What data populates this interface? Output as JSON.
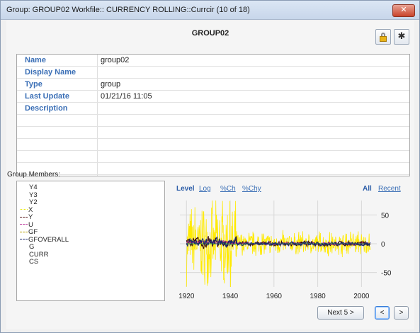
{
  "window": {
    "title": "Group: GROUP02   Workfile:: CURRENCY ROLLING::Currcir (10 of 18)",
    "close_glyph": "✕"
  },
  "header": {
    "title": "GROUP02",
    "lock_icon": "lock-icon",
    "pin_icon": "pin-icon",
    "pin_glyph": "✱"
  },
  "info": [
    {
      "label": "Name",
      "value": "group02"
    },
    {
      "label": "Display Name",
      "value": ""
    },
    {
      "label": "Type",
      "value": "group"
    },
    {
      "label": "Last Update",
      "value": "01/21/16  11:05"
    },
    {
      "label": "Description",
      "value": ""
    }
  ],
  "members_label": "Group Members:",
  "members": [
    {
      "name": "Y4",
      "line": "none",
      "color": ""
    },
    {
      "name": "Y3",
      "line": "none",
      "color": ""
    },
    {
      "name": "Y2",
      "line": "none",
      "color": ""
    },
    {
      "name": "X",
      "line": "dotted",
      "color": "#e8e800"
    },
    {
      "name": "Y",
      "line": "dashed",
      "color": "#5a1a1a"
    },
    {
      "name": "U",
      "line": "dashed",
      "color": "#c040a0"
    },
    {
      "name": "GF",
      "line": "dashed",
      "color": "#b8a000"
    },
    {
      "name": "GFOVERALL",
      "line": "dashed",
      "color": "#1a2a6a"
    },
    {
      "name": "G",
      "line": "none",
      "color": ""
    },
    {
      "name": "CURR",
      "line": "none",
      "color": ""
    },
    {
      "name": "CS",
      "line": "none",
      "color": ""
    }
  ],
  "graph_tabs": {
    "level": "Level",
    "log": "Log",
    "pch": "%Ch",
    "pchy": "%Chy",
    "all": "All",
    "recent": "Recent"
  },
  "chart_data": {
    "type": "line",
    "x_ticks": [
      "1920",
      "1940",
      "1960",
      "1980",
      "2000"
    ],
    "y_ticks": [
      "50",
      "0",
      "-50"
    ],
    "xlim": [
      1917,
      2007
    ],
    "ylim": [
      -75,
      75
    ],
    "grid": true,
    "series": [
      {
        "color": "#ffea00",
        "style": "volatile",
        "amp_early": 60,
        "amp_late": 18
      },
      {
        "color": "#3b0a0a",
        "style": "level",
        "amp_early": 9,
        "amp_late": 4
      },
      {
        "color": "#c02a8a",
        "style": "level",
        "amp_early": 3,
        "amp_late": 2
      },
      {
        "color": "#3aa84a",
        "style": "flat",
        "amp_early": 1,
        "amp_late": 1
      },
      {
        "color": "#1a2a6a",
        "style": "level",
        "amp_early": 7,
        "amp_late": 3
      }
    ]
  },
  "buttons": {
    "next5": "Next 5 >",
    "prev": "<",
    "next": ">"
  }
}
